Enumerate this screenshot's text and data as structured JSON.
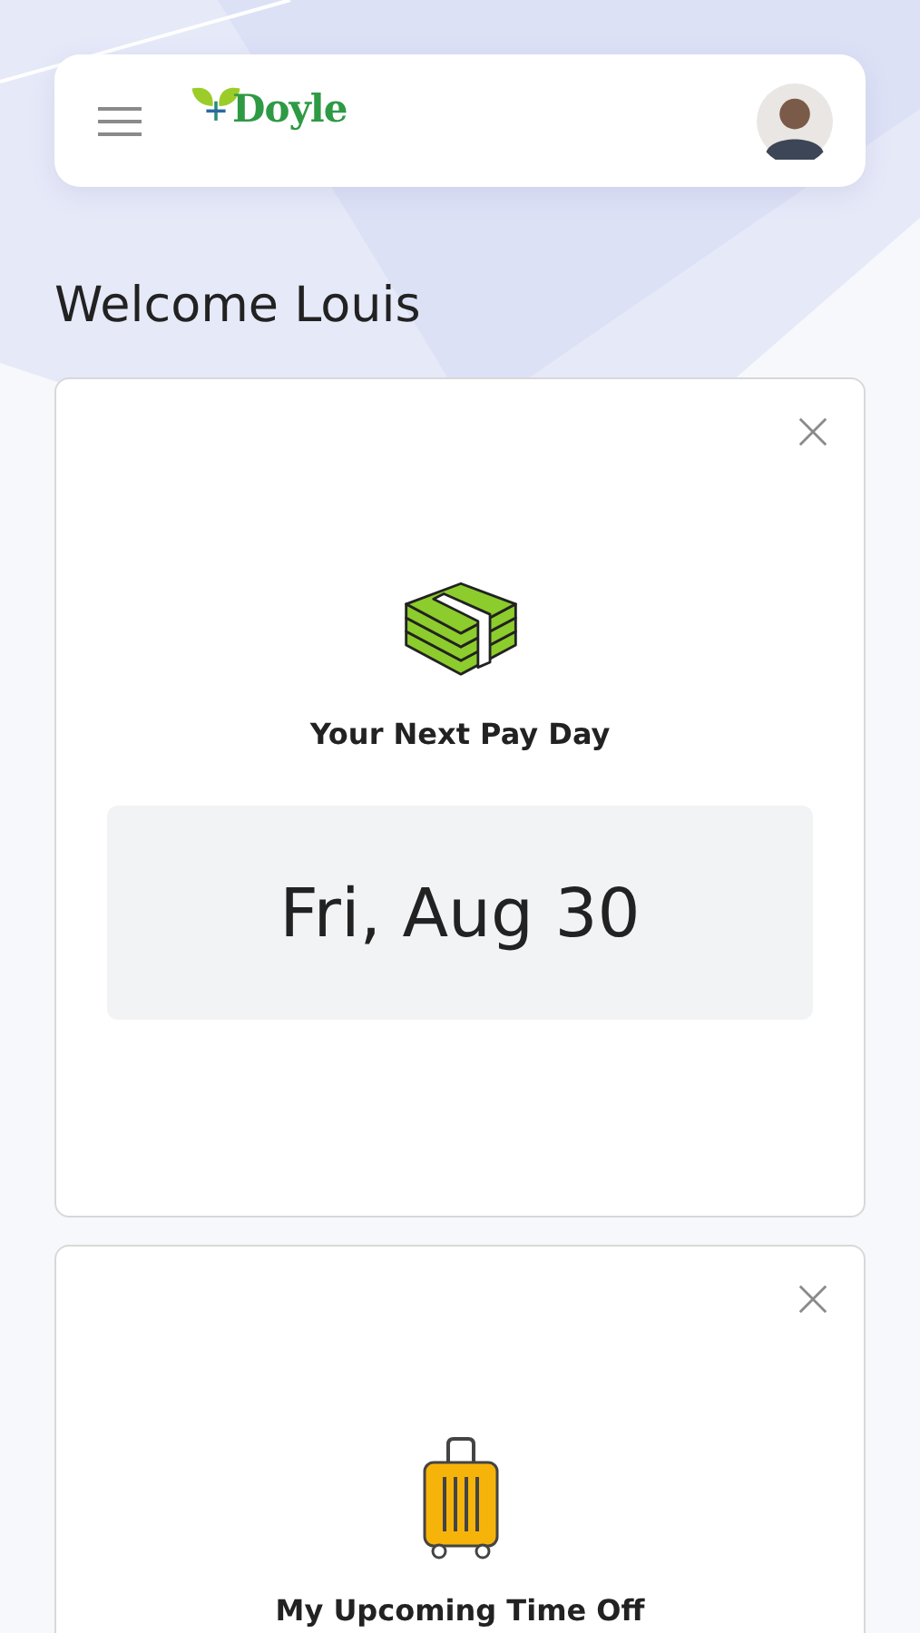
{
  "header": {
    "logo_text": "Doyle"
  },
  "greeting": "Welcome Louis",
  "cards": [
    {
      "kind": "payday",
      "title": "Your Next Pay Day",
      "value": "Fri, Aug 30"
    },
    {
      "kind": "timeoff",
      "title": "My Upcoming Time Off"
    }
  ]
}
